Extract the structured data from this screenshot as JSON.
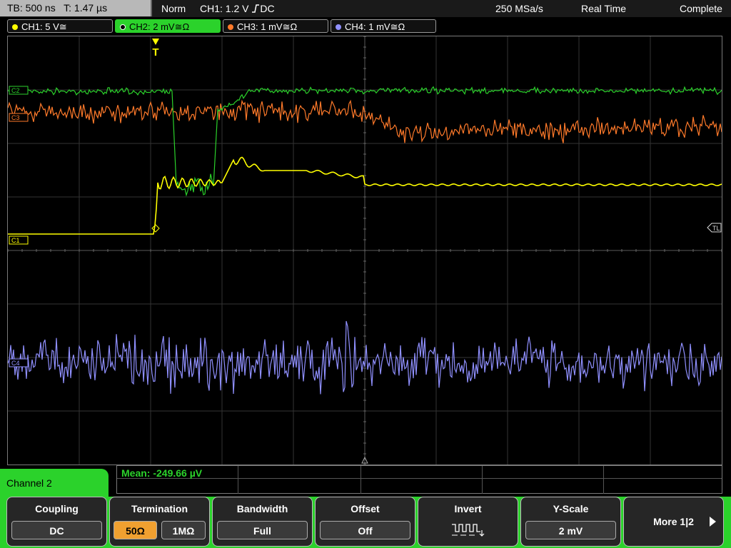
{
  "status_bar": {
    "timebase": "TB: 500 ns",
    "trigger_time": "T: 1.47 µs",
    "trigger_mode": "Norm",
    "trigger_source": "CH1: 1.2 V",
    "trigger_coupling": "DC",
    "sample_rate": "250 MSa/s",
    "acq_mode": "Real Time",
    "acq_status": "Complete"
  },
  "channels": [
    {
      "label": "CH1: 5 V≅",
      "color": "#ffff00",
      "marker": "C1"
    },
    {
      "label": "CH2: 2 mV≅Ω",
      "color": "#2bd22b",
      "marker": "C2"
    },
    {
      "label": "CH3: 1 mV≅Ω",
      "color": "#ff7a2a",
      "marker": "C3"
    },
    {
      "label": "CH4: 1 mV≅Ω",
      "color": "#9090ff",
      "marker": "C4"
    }
  ],
  "trigger": {
    "marker": "T",
    "level_marker": "TL"
  },
  "measurement": {
    "mean": "Mean: -249.66 µV"
  },
  "menu": {
    "title": "Channel 2",
    "coupling": {
      "title": "Coupling",
      "value": "DC"
    },
    "termination": {
      "title": "Termination",
      "opt1": "50Ω",
      "opt2": "1MΩ"
    },
    "bandwidth": {
      "title": "Bandwidth",
      "value": "Full"
    },
    "offset": {
      "title": "Offset",
      "value": "Off"
    },
    "invert": {
      "title": "Invert",
      "icon": "square-wave-icon"
    },
    "yscale": {
      "title": "Y-Scale",
      "value": "2 mV"
    },
    "more": "More 1|2"
  }
}
